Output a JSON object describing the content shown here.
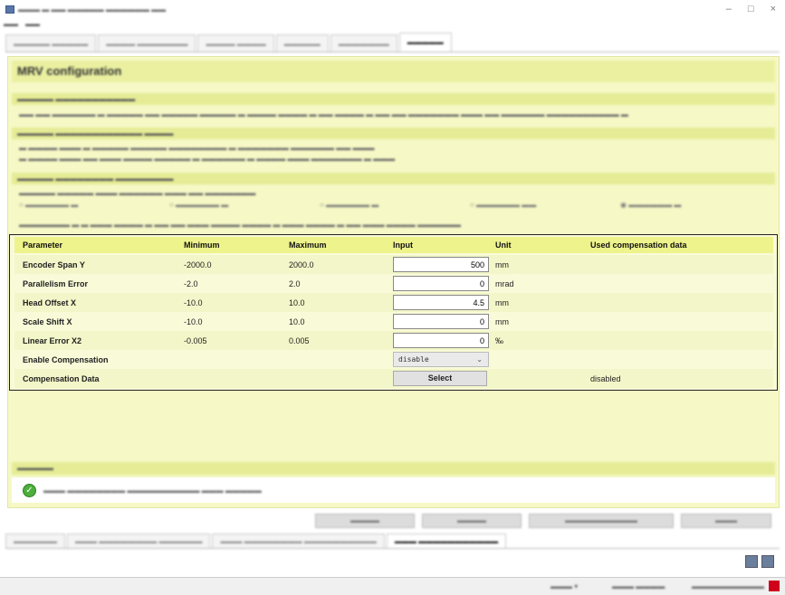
{
  "window": {
    "title": "MRV configuration"
  },
  "panel": {
    "title": "MRV configuration"
  },
  "table": {
    "headers": [
      "Parameter",
      "Minimum",
      "Maximum",
      "Input",
      "Unit",
      "Used compensation data"
    ],
    "rows": [
      {
        "name": "Encoder Span Y",
        "min": "-2000.0",
        "max": "2000.0",
        "input": "500",
        "unit": "mm"
      },
      {
        "name": "Parallelism Error",
        "min": "-2.0",
        "max": "2.0",
        "input": "0",
        "unit": "mrad"
      },
      {
        "name": "Head Offset X",
        "min": "-10.0",
        "max": "10.0",
        "input": "4.5",
        "unit": "mm"
      },
      {
        "name": "Scale Shift X",
        "min": "-10.0",
        "max": "10.0",
        "input": "0",
        "unit": "mm"
      },
      {
        "name": "Linear Error X2",
        "min": "-0.005",
        "max": "0.005",
        "input": "0",
        "unit": "‰"
      }
    ],
    "enable_compensation": {
      "label": "Enable Compensation",
      "value": "disable"
    },
    "compensation_data": {
      "label": "Compensation Data",
      "button": "Select",
      "used": "disabled"
    }
  },
  "icons": {
    "ok": "check-circle-icon",
    "save": "save-icon",
    "tools": "tools-icon"
  }
}
